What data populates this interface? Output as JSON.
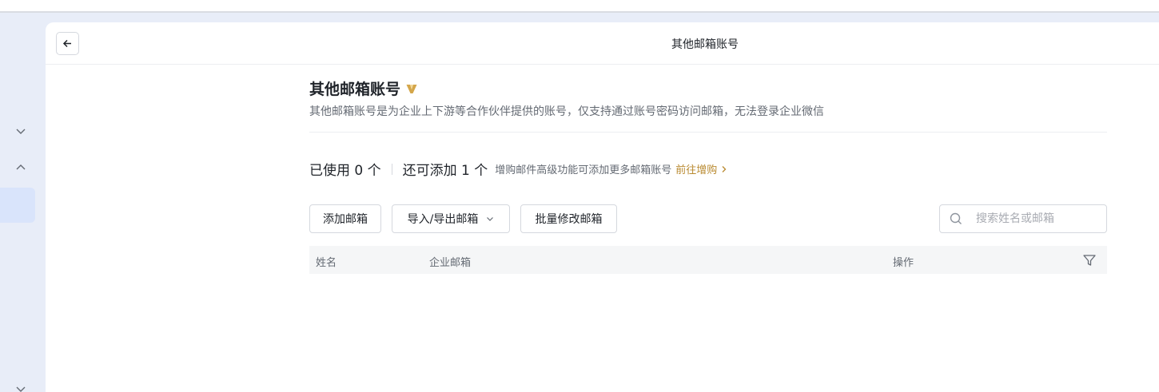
{
  "header": {
    "title": "其他邮箱账号"
  },
  "page": {
    "title": "其他邮箱账号",
    "description": "其他邮箱账号是为企业上下游等合作伙伴提供的账号，仅支持通过账号密码访问邮箱，无法登录企业微信"
  },
  "usage": {
    "used": "已使用 0 个",
    "remaining": "还可添加 1 个",
    "tip": "增购邮件高级功能可添加更多邮箱账号",
    "link": "前往增购"
  },
  "toolbar": {
    "add_label": "添加邮箱",
    "import_export_label": "导入/导出邮箱",
    "batch_edit_label": "批量修改邮箱"
  },
  "search": {
    "placeholder": "搜索姓名或邮箱"
  },
  "table": {
    "columns": [
      "姓名",
      "企业邮箱",
      "操作"
    ]
  },
  "colors": {
    "accent_gold": "#b98a30",
    "rail_bg": "#e8edf8",
    "rail_active": "#d9e4fb"
  },
  "icons": {
    "back": "arrow-left-icon",
    "vip": "vip-badge-icon",
    "search": "search-icon",
    "filter": "filter-icon"
  }
}
